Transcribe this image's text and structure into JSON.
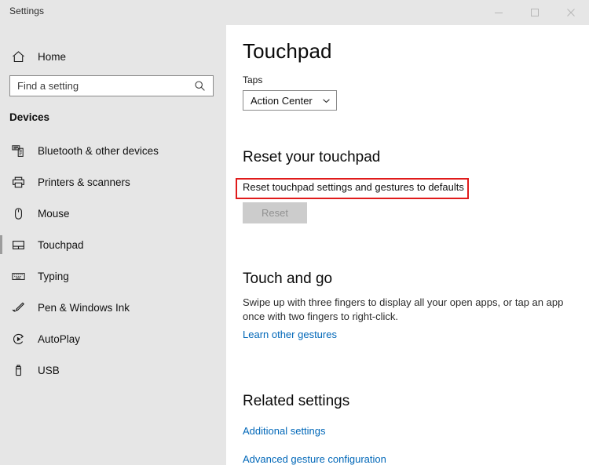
{
  "window": {
    "title": "Settings",
    "controls": [
      {
        "name": "minimize",
        "label": "Minimize"
      },
      {
        "name": "maximize",
        "label": "Maximize"
      },
      {
        "name": "close",
        "label": "Close"
      }
    ]
  },
  "sidebar": {
    "home_label": "Home",
    "home_icon": "home-icon",
    "search": {
      "placeholder": "Find a setting",
      "value": "",
      "icon": "search-icon"
    },
    "category": "Devices",
    "items": [
      {
        "label": "Bluetooth & other devices",
        "icon": "bluetooth-devices-icon",
        "selected": false
      },
      {
        "label": "Printers & scanners",
        "icon": "printer-icon",
        "selected": false
      },
      {
        "label": "Mouse",
        "icon": "mouse-icon",
        "selected": false
      },
      {
        "label": "Touchpad",
        "icon": "touchpad-icon",
        "selected": true
      },
      {
        "label": "Typing",
        "icon": "keyboard-icon",
        "selected": false
      },
      {
        "label": "Pen & Windows Ink",
        "icon": "pen-icon",
        "selected": false
      },
      {
        "label": "AutoPlay",
        "icon": "autoplay-icon",
        "selected": false
      },
      {
        "label": "USB",
        "icon": "usb-icon",
        "selected": false
      }
    ]
  },
  "main": {
    "page_title": "Touchpad",
    "taps": {
      "label": "Taps",
      "selected": "Action Center",
      "chevron_icon": "chevron-down-icon"
    },
    "reset": {
      "heading": "Reset your touchpad",
      "description": "Reset touchpad settings and gestures to defaults",
      "button_label": "Reset",
      "button_disabled": true,
      "highlight_color": "#e01b1b"
    },
    "touch_and_go": {
      "heading": "Touch and go",
      "description": "Swipe up with three fingers to display all your open apps, or tap an app once with two fingers to right-click.",
      "link_label": "Learn other gestures"
    },
    "related_settings": {
      "heading": "Related settings",
      "links": [
        {
          "label": "Additional settings"
        },
        {
          "label": "Advanced gesture configuration"
        }
      ]
    }
  },
  "theme": {
    "accent_link": "#0067b8",
    "sidebar_bg": "#e6e6e6",
    "content_bg": "#ffffff",
    "highlight": "#e01b1b"
  }
}
